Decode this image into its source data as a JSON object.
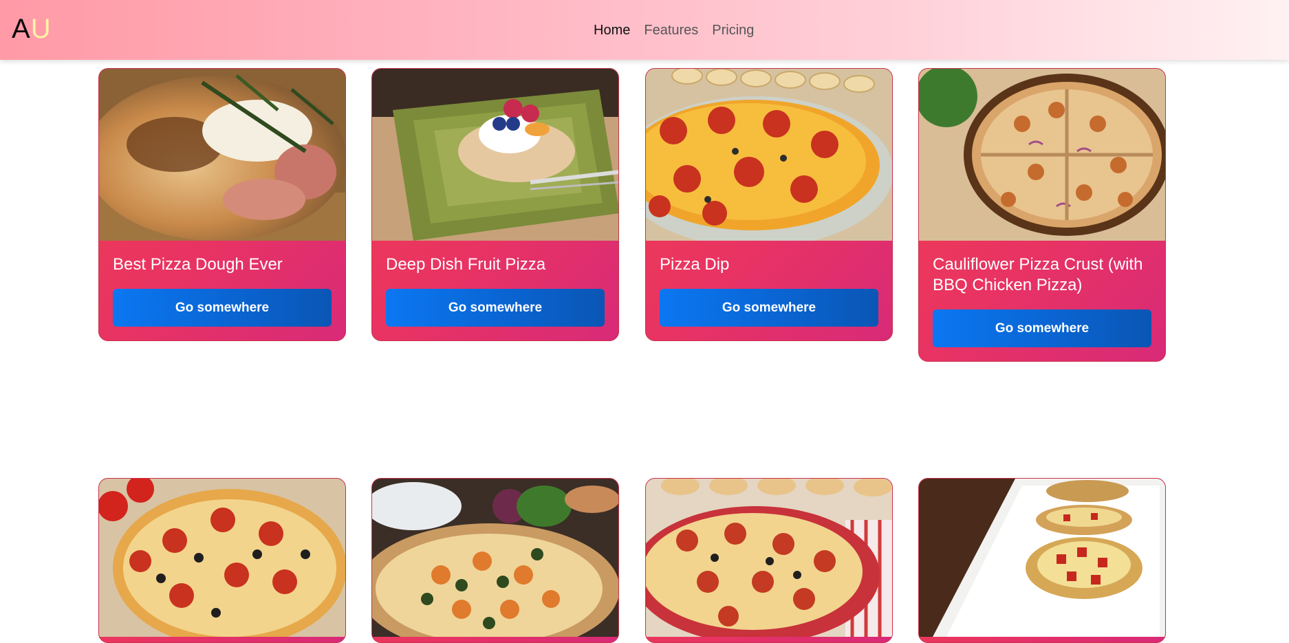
{
  "brand": {
    "first": "A",
    "second": "U"
  },
  "nav": {
    "items": [
      {
        "label": "Home",
        "active": true
      },
      {
        "label": "Features",
        "active": false
      },
      {
        "label": "Pricing",
        "active": false
      }
    ]
  },
  "cards_row1": [
    {
      "title": "Best Pizza Dough Ever",
      "button": "Go somewhere",
      "image": "pizza-crust-closeup"
    },
    {
      "title": "Deep Dish Fruit Pizza",
      "button": "Go somewhere",
      "image": "fruit-pizza-slice-plate"
    },
    {
      "title": "Pizza Dip",
      "button": "Go somewhere",
      "image": "pepperoni-pizza-dip-dish"
    },
    {
      "title": "Cauliflower Pizza Crust (with BBQ Chicken Pizza)",
      "button": "Go somewhere",
      "image": "bbq-chicken-pizza"
    }
  ],
  "cards_row2": [
    {
      "image": "pepperoni-olive-pizza"
    },
    {
      "image": "sweet-potato-kale-pizza"
    },
    {
      "image": "pepperoni-pizza-skillet"
    },
    {
      "image": "potato-skin-bites"
    }
  ],
  "colors": {
    "card_gradient_start": "#f23e50",
    "card_gradient_end": "#d82a78",
    "button_blue": "#0b77f2",
    "brand_u": "#fff3a6"
  }
}
